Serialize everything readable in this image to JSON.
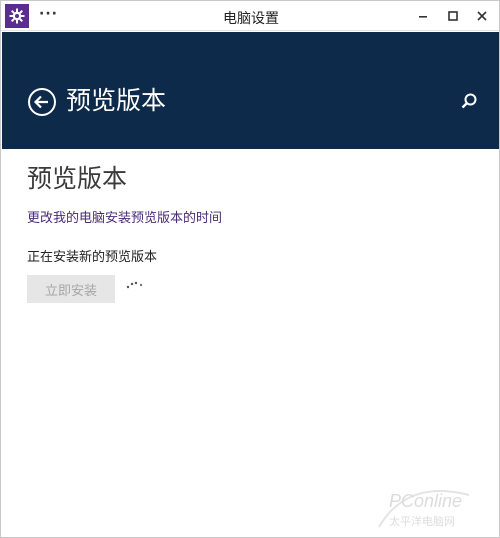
{
  "window": {
    "title": "电脑设置",
    "menu_icon": "more-dots-icon",
    "app_icon": "gear-icon",
    "controls": [
      "minimize-icon",
      "maximize-icon",
      "close-icon"
    ]
  },
  "header": {
    "title": "预览版本",
    "back_icon": "back-arrow-icon",
    "search_icon": "search-icon",
    "background": "#0e2a4a"
  },
  "content": {
    "page_title": "预览版本",
    "change_link": "更改我的电脑安装预览版本的时间",
    "status": "正在安装新的预览版本",
    "install_button": "立即安装"
  },
  "colors": {
    "accent": "#5b2d91",
    "link": "#4b2a7a",
    "header": "#0e2a4a"
  },
  "watermark": {
    "brand": "PConline",
    "subtitle": "太平洋电脑网"
  }
}
